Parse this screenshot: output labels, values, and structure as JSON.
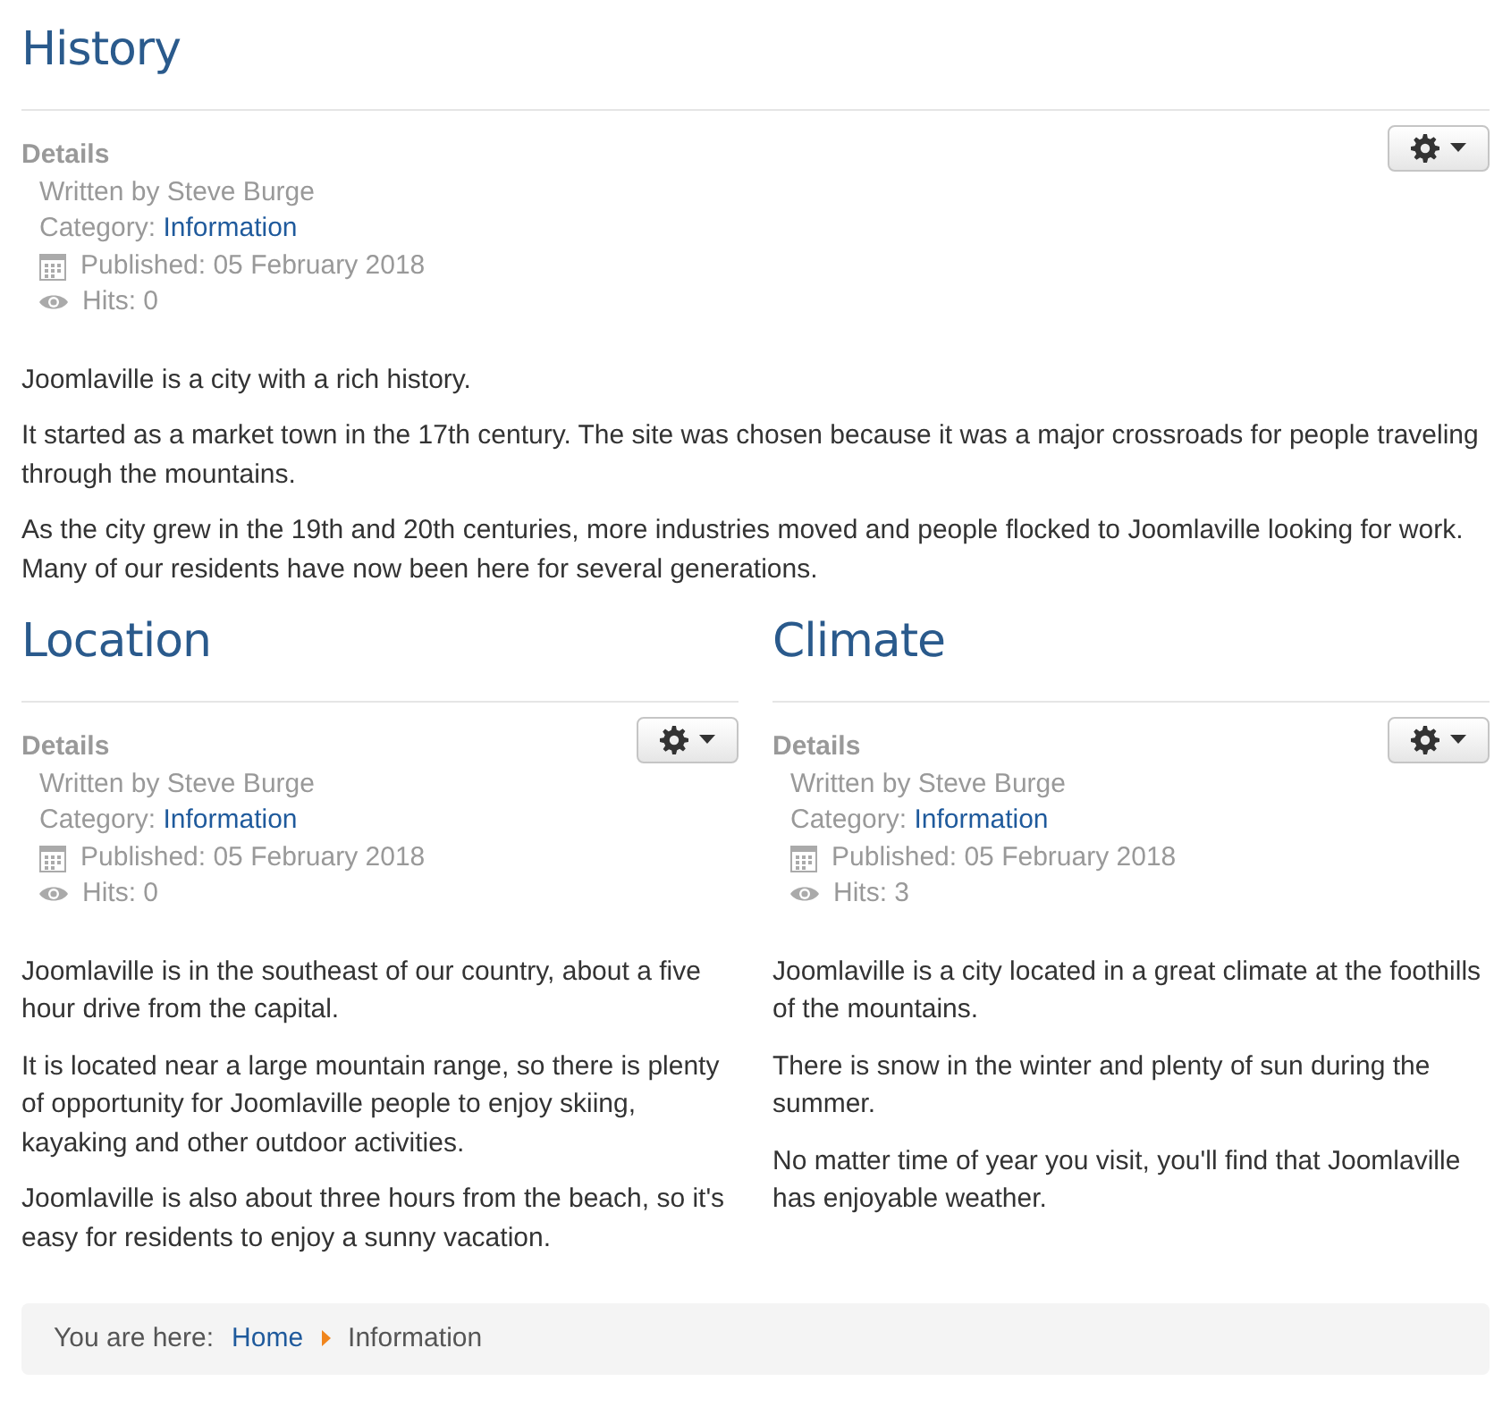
{
  "lead": {
    "title": "History",
    "details_label": "Details",
    "author": "Written by Steve Burge",
    "category_label": "Category:",
    "category": "Information",
    "published": "Published: 05 February 2018",
    "hits": "Hits: 0",
    "paragraphs": [
      "Joomlaville is a city with a rich history.",
      "It started as a market town in the 17th century. The site was chosen because it was a major crossroads for people traveling through the mountains.",
      "As the city grew in the 19th and 20th centuries, more industries moved and people flocked to Joomlaville looking for work. Many of our residents have now been here for several generations."
    ]
  },
  "columns": [
    {
      "title": "Location",
      "details_label": "Details",
      "author": "Written by Steve Burge",
      "category_label": "Category:",
      "category": "Information",
      "published": "Published: 05 February 2018",
      "hits": "Hits: 0",
      "paragraphs": [
        "Joomlaville is in the southeast of our country, about a five hour drive from the capital.",
        "It is located near a large mountain range, so there is plenty of opportunity for Joomlaville people to enjoy skiing, kayaking and other outdoor activities.",
        "Joomlaville is also about three hours from the beach, so it's easy for residents to enjoy a sunny vacation."
      ]
    },
    {
      "title": "Climate",
      "details_label": "Details",
      "author": "Written by Steve Burge",
      "category_label": "Category:",
      "category": "Information",
      "published": "Published: 05 February 2018",
      "hits": "Hits: 3",
      "paragraphs": [
        "Joomlaville is a city located in a great climate at the foothills of the mountains.",
        "There is snow in the winter and plenty of sun during the summer.",
        "No matter time of year you visit, you'll find that Joomlaville has enjoyable weather."
      ]
    }
  ],
  "breadcrumb": {
    "label": "You are here:",
    "items": [
      "Home",
      "Information"
    ]
  }
}
